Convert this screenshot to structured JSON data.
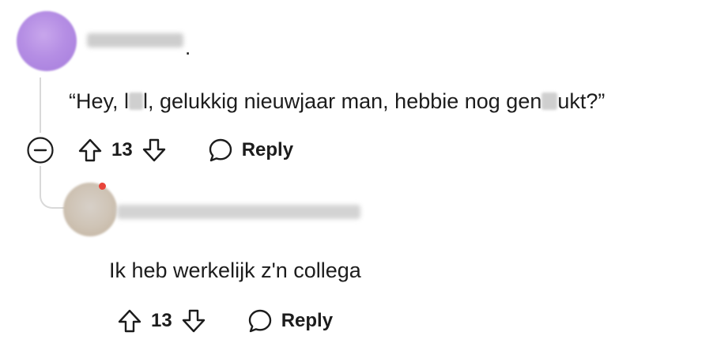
{
  "comments": [
    {
      "username_hidden": true,
      "separator": ".",
      "text_parts": [
        "“Hey, l",
        "l, gelukkig nieuwjaar man, hebbie nog gen",
        "ukt?”"
      ],
      "votes": "13",
      "reply_label": "Reply",
      "collapse_icon": "minus-circle-icon",
      "avatar_color": "#b58ee4"
    },
    {
      "username_hidden": true,
      "text": "Ik heb werkelijk z'n collega",
      "votes": "13",
      "reply_label": "Reply",
      "avatar_color": "#cfc4b6"
    }
  ],
  "icons": {
    "upvote": "arrow-up-outline-icon",
    "downvote": "arrow-down-outline-icon",
    "reply": "speech-bubble-icon",
    "collapse": "minus-circle-icon"
  },
  "colors": {
    "text": "#1c1c1c",
    "thread_line": "#d9d9d9",
    "background": "#ffffff"
  }
}
